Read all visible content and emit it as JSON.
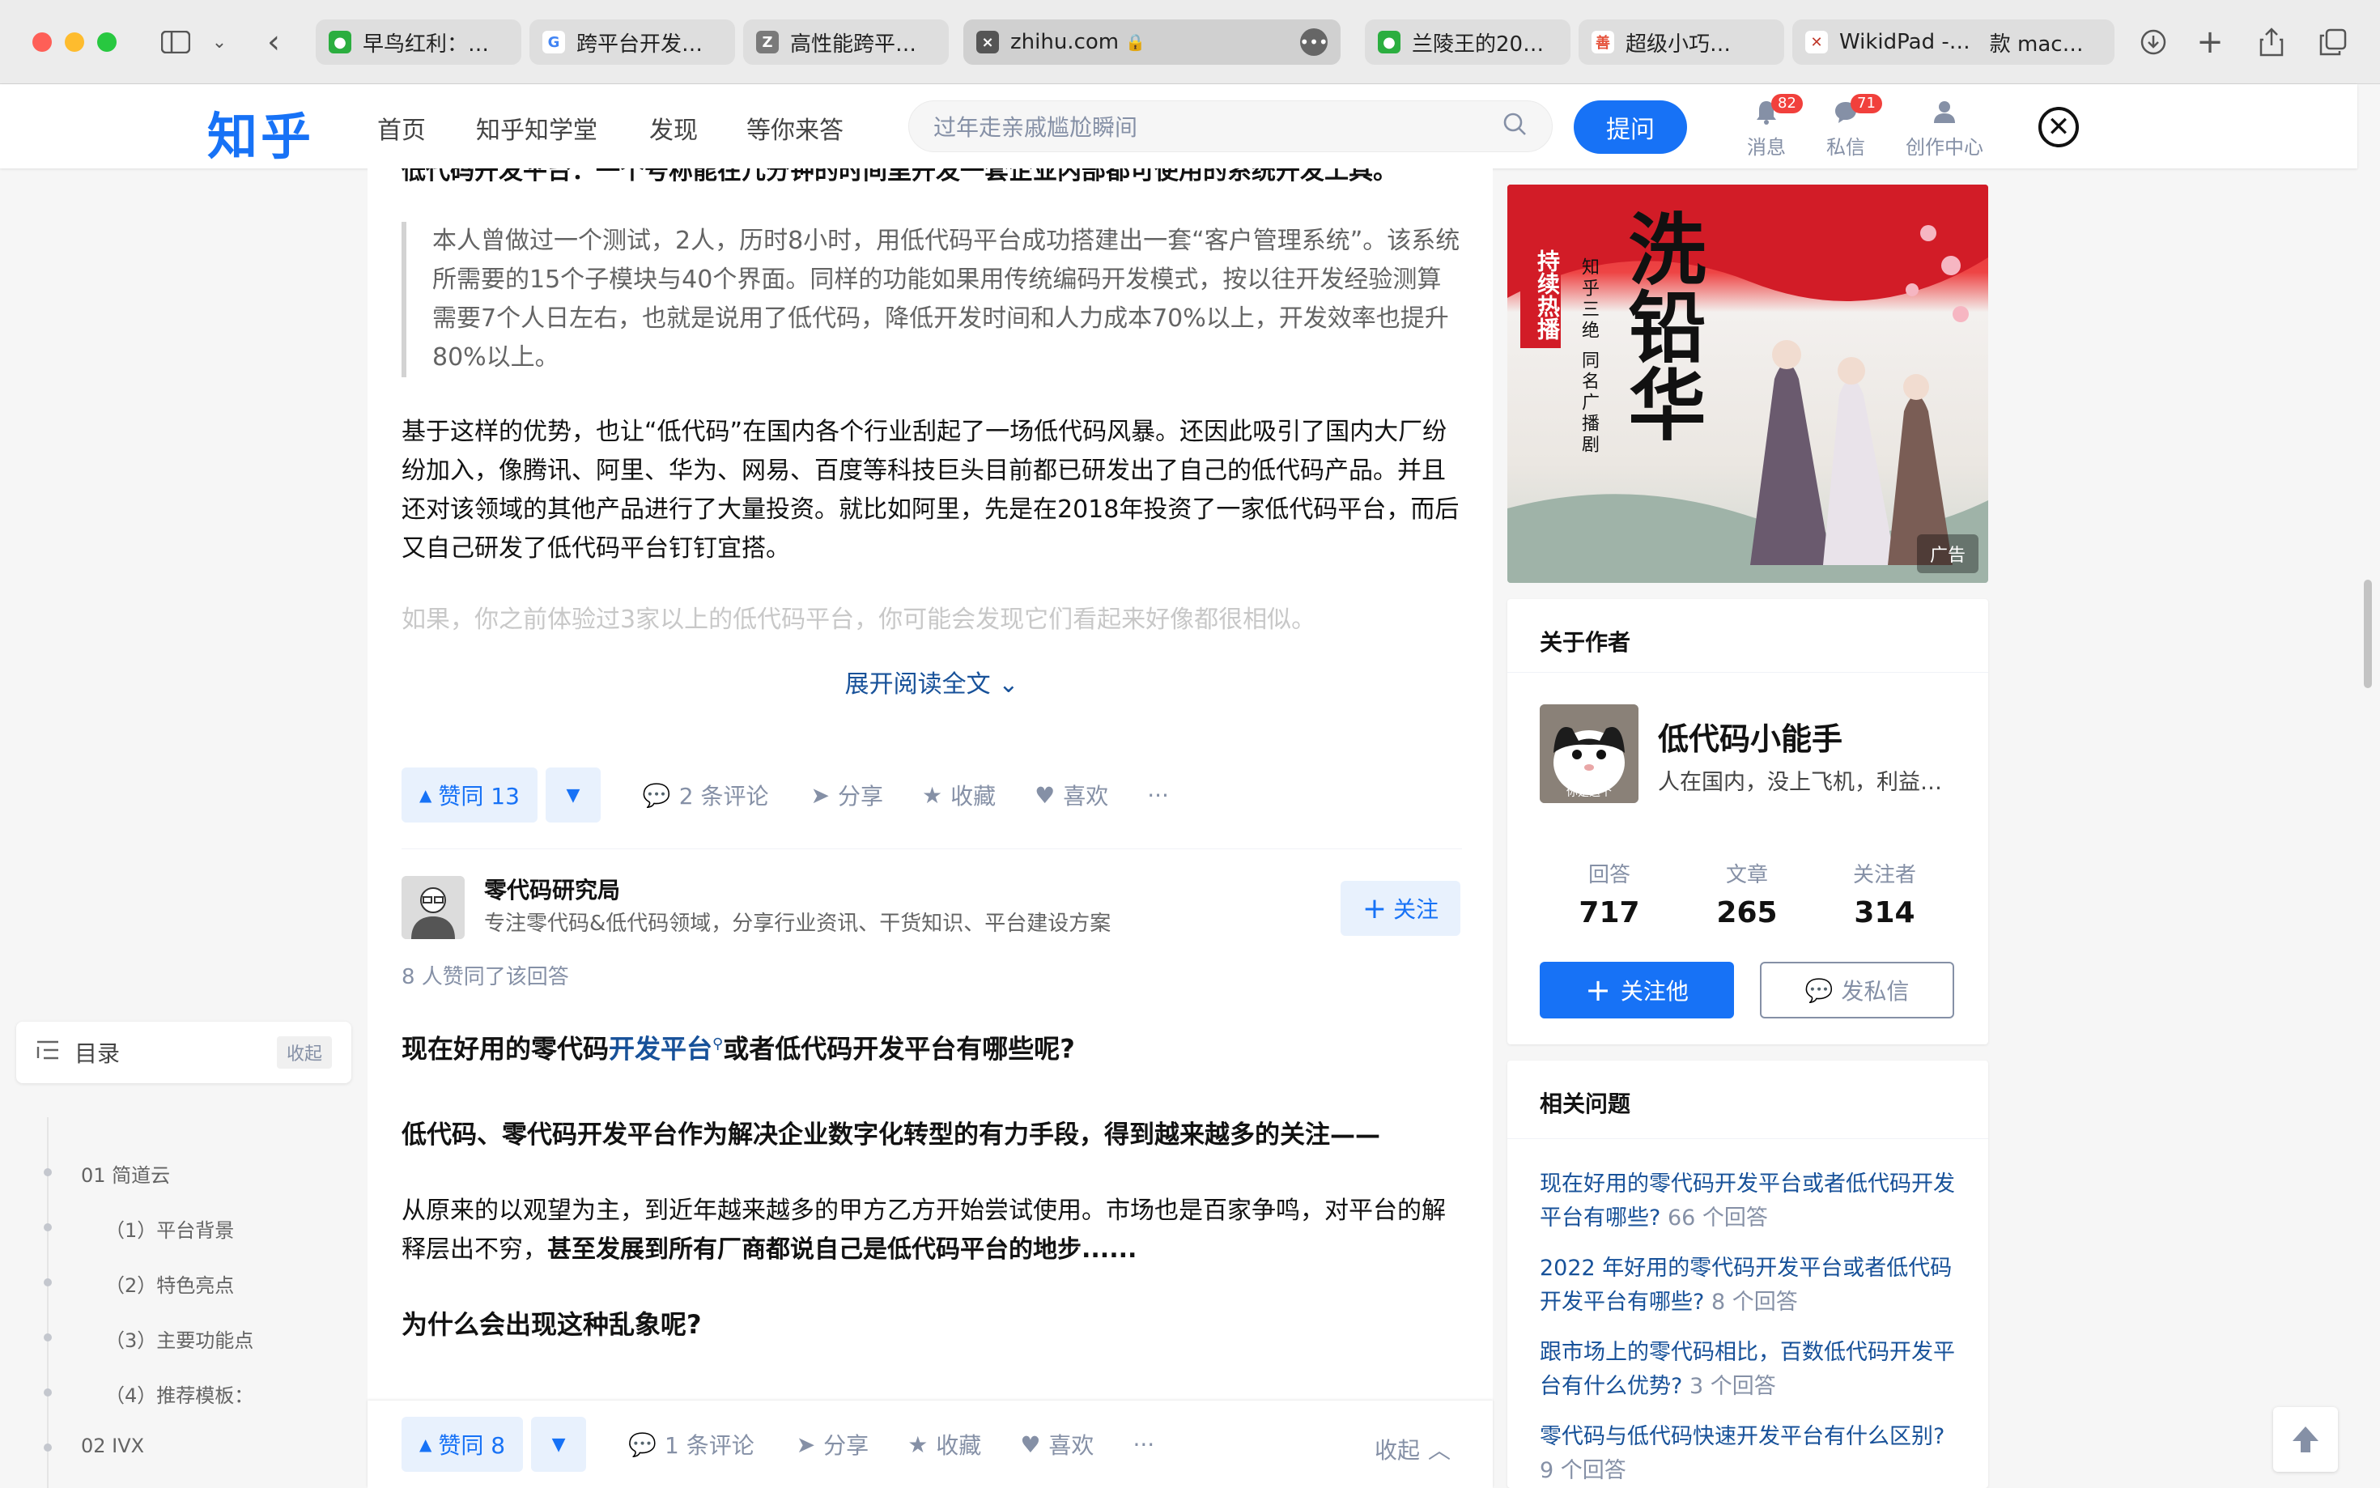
{
  "browser": {
    "tabs": [
      {
        "title": "早鸟红利：…",
        "color": "#2bae3f",
        "glyph": "●"
      },
      {
        "title": "跨平台开发…",
        "color": "#4285f4",
        "glyph": "G"
      },
      {
        "title": "高性能跨平…",
        "color": "#7a7a7a",
        "glyph": "Z"
      },
      {
        "title": "zhihu.com",
        "color": "#555555",
        "glyph": "×"
      },
      {
        "title": "兰陵王的20…",
        "color": "#2bae3f",
        "glyph": "●"
      },
      {
        "title": "超级小巧…",
        "color": "#e5533c",
        "glyph": "善"
      },
      {
        "title": "WikidPad -…",
        "color": "#c0392b",
        "glyph": "✕"
      }
    ],
    "extra_tab_text": "款 mac…"
  },
  "header": {
    "logo": "知乎",
    "nav": [
      "首页",
      "知乎知学堂",
      "发现",
      "等你来答"
    ],
    "search_placeholder": "过年走亲戚尴尬瞬间",
    "ask_label": "提问",
    "messages": {
      "label": "消息",
      "count": "82"
    },
    "dms": {
      "label": "私信",
      "count": "71"
    },
    "creator": {
      "label": "创作中心"
    }
  },
  "article1": {
    "top_line": "低代码开发平台：一个号称能在几分钟的时间里开发一套企业内部都可使用的系统开发工具。",
    "quote": "本人曾做过一个测试，2人，历时8小时，用低代码平台成功搭建出一套“客户管理系统”。该系统所需要的15个子模块与40个界面。同样的功能如果用传统编码开发模式，按以往开发经验测算需要7个人日左右，也就是说用了低代码，降低开发时间和人力成本70%以上，开发效率也提升80%以上。",
    "para": "基于这样的优势，也让“低代码”在国内各个行业刮起了一场低代码风暴。还因此吸引了国内大厂纷纷加入，像腾讯、阿里、华为、网易、百度等科技巨头目前都已研发出了自己的低代码产品。并且还对该领域的其他产品进行了大量投资。就比如阿里，先是在2018年投资了一家低代码平台，而后又自己研发了低代码平台钉钉宜搭。",
    "faded": "如果，你之前体验过3家以上的低代码平台，你可能会发现它们看起来好像都很相似。",
    "expand": "展开阅读全文",
    "actions": {
      "vote": "赞同 13",
      "comments": "2 条评论",
      "share": "分享",
      "collect": "收藏",
      "like": "喜欢"
    }
  },
  "article2": {
    "author_name": "零代码研究局",
    "author_bio": "专注零代码&低代码领域，分享行业资讯、干货知识、平台建设方案",
    "follow": "关注",
    "votes_note": "8 人赞同了该回答",
    "heading_a": "现在好用的零代码",
    "heading_link": "开发平台",
    "heading_b": "或者低代码开发平台有哪些呢?",
    "subheading": "低代码、零代码开发平台作为解决企业数字化转型的有力手段，得到越来越多的关注——",
    "para_a": "从原来的以观望为主，到近年越来越多的甲方乙方开始尝试使用。市场也是百家争鸣，对平台的解释层出不穷，",
    "para_b": "甚至发展到所有厂商都说自己是低代码平台的地步......",
    "heading2": "为什么会出现这种乱象呢?"
  },
  "sticky": {
    "vote": "赞同 8",
    "comments": "1 条评论",
    "share": "分享",
    "collect": "收藏",
    "like": "喜欢",
    "fold": "收起"
  },
  "toc": {
    "title": "目录",
    "collapse": "收起",
    "items": [
      "01 简道云",
      "（1）平台背景",
      "（2）特色亮点",
      "（3）主要功能点",
      "（4）推荐模板：",
      "02 IVX"
    ]
  },
  "ad": {
    "tag": "广告",
    "badge": "持续热播",
    "title": "洗铅华",
    "subtitle": "知乎三绝 同名广播剧"
  },
  "author_card": {
    "title": "关于作者",
    "name": "低代码小能手",
    "bio": "人在国内，没上飞机，利益…",
    "avatar_caption": "你是这个",
    "stats": [
      {
        "label": "回答",
        "value": "717"
      },
      {
        "label": "文章",
        "value": "265"
      },
      {
        "label": "关注者",
        "value": "314"
      }
    ],
    "follow_btn": "关注他",
    "dm_btn": "发私信"
  },
  "related": {
    "title": "相关问题",
    "items": [
      {
        "q": "现在好用的零代码开发平台或者低代码开发平台有哪些?",
        "count": "66 个回答"
      },
      {
        "q": "2022 年好用的零代码开发平台或者低代码开发平台有哪些?",
        "count": "8 个回答"
      },
      {
        "q": "跟市场上的零代码相比，百数低代码开发平台有什么优势?",
        "count": "3 个回答"
      },
      {
        "q": "零代码与低代码快速开发平台有什么区别?",
        "count": "9 个回答"
      }
    ]
  }
}
